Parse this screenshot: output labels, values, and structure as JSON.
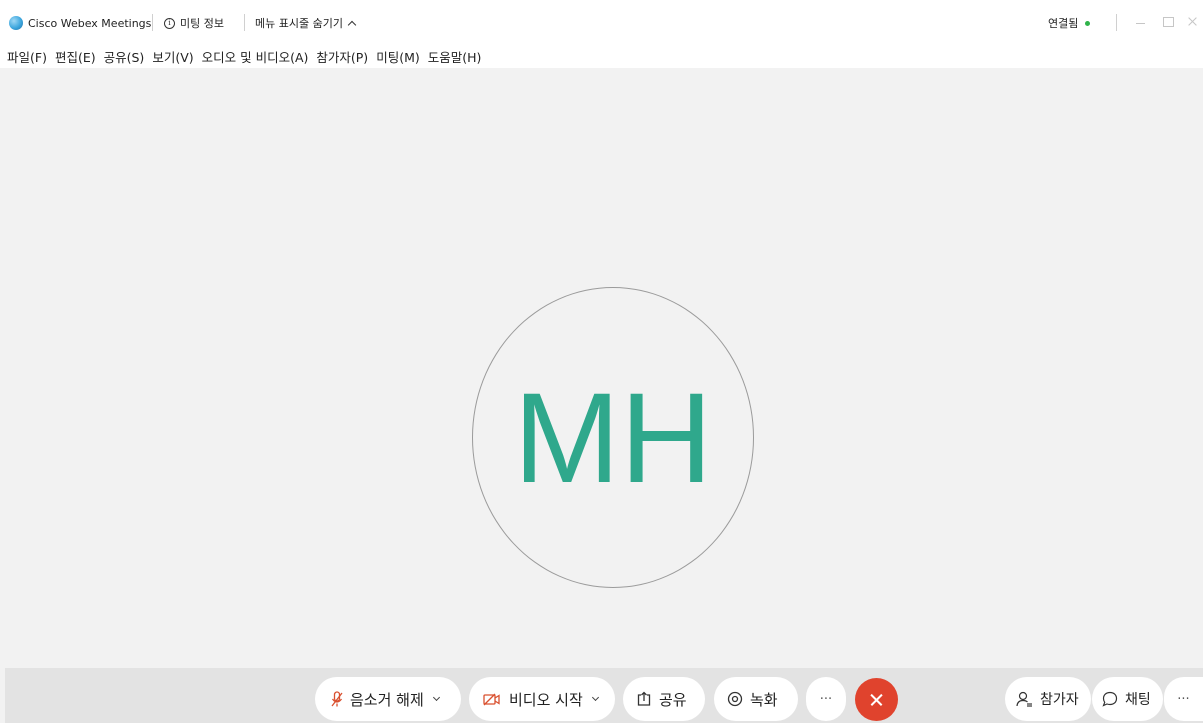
{
  "titlebar": {
    "app_name": "Cisco Webex Meetings",
    "meeting_info": "미팅 정보",
    "hide_menu": "메뉴 표시줄 숨기기",
    "connection_status": "연결됨"
  },
  "menu": {
    "items": [
      "파일(F)",
      "편집(E)",
      "공유(S)",
      "보기(V)",
      "오디오 및 비디오(A)",
      "참가자(P)",
      "미팅(M)",
      "도움말(H)"
    ]
  },
  "stage": {
    "initials": "MH",
    "initials_color": "#2fa88c"
  },
  "controls": {
    "unmute": "음소거 해제",
    "start_video": "비디오 시작",
    "share": "공유",
    "record": "녹화",
    "more": "···",
    "participants": "참가자",
    "chat": "채팅",
    "more2": "···",
    "leave_color": "#e0432d",
    "muted_icon_color": "#d9502f"
  }
}
